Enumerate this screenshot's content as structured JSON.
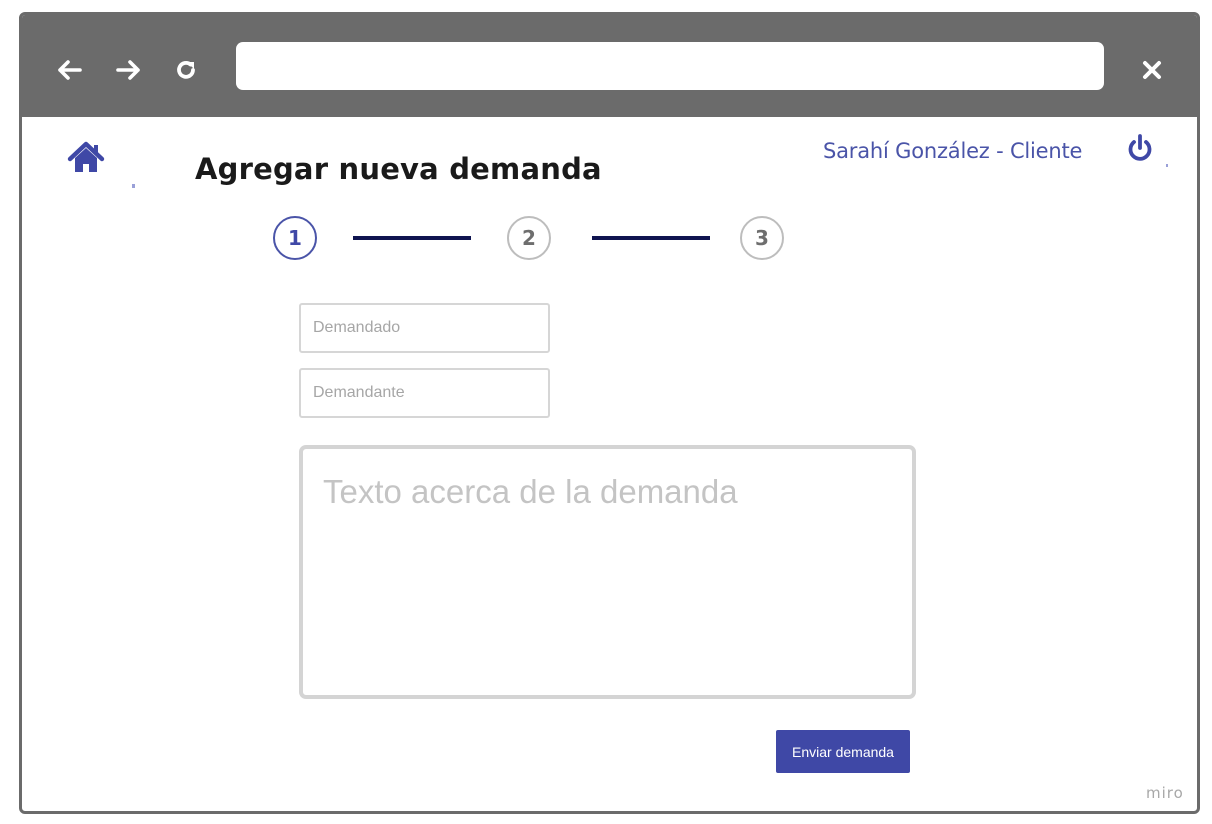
{
  "browser": {
    "back_icon": "arrow-left-icon",
    "forward_icon": "arrow-right-icon",
    "reload_icon": "reload-icon",
    "close_icon": "close-icon",
    "url_value": ""
  },
  "header": {
    "home_icon": "home-icon",
    "title": "Agregar nueva demanda",
    "user_label": "Sarahí González - Cliente",
    "power_icon": "power-icon"
  },
  "stepper": {
    "steps": [
      "1",
      "2",
      "3"
    ],
    "active_index": 0
  },
  "form": {
    "demandado_placeholder": "Demandado",
    "demandado_value": "",
    "demandante_placeholder": "Demandante",
    "demandante_value": "",
    "texto_placeholder": "Texto acerca de la demanda",
    "texto_value": "",
    "submit_label": "Enviar demanda"
  },
  "watermark": "miro",
  "colors": {
    "chrome": "#6b6b6b",
    "accent": "#3f48a6",
    "connector": "#0f1450",
    "user_text": "#4a54a8"
  }
}
